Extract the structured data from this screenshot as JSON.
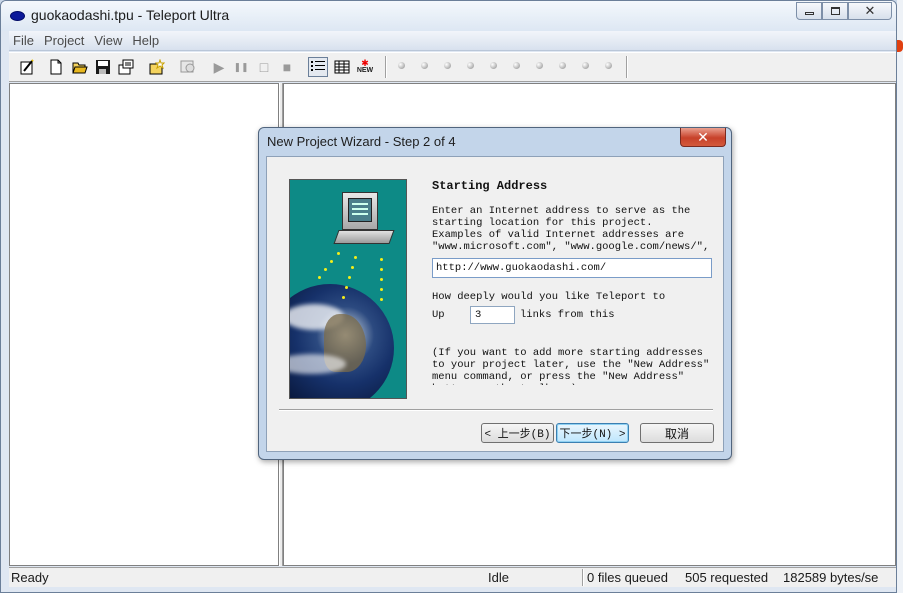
{
  "window": {
    "title": "guokaodashi.tpu - Teleport Ultra",
    "close_glyph": "✕"
  },
  "menu": [
    "File",
    "Project",
    "View",
    "Help"
  ],
  "toolbar": {
    "icons": [
      "new-wizard-icon",
      "new-file-icon",
      "open-folder-icon",
      "save-icon",
      "properties-icon",
      "new-project-icon",
      "browse-icon",
      "play-icon",
      "pause-icon",
      "stop-icon",
      "stop-all-icon",
      "list-view-icon",
      "grid-view-icon",
      "new-badge-icon"
    ],
    "play_glyph": "▶",
    "pause_glyph": "❚❚",
    "stop_glyph": "□",
    "stop_all_glyph": "■",
    "new_label": "NEW"
  },
  "status": {
    "ready": "Ready",
    "idle": "Idle",
    "files_queued": "0 files queued",
    "requested": "505 requested",
    "rate": "182589 bytes/se"
  },
  "dialog": {
    "title": "New Project Wizard - Step 2 of 4",
    "close_glyph": "✕",
    "heading": "Starting Address",
    "description": "Enter an Internet address to serve as the starting location for this project.  Examples of valid Internet addresses are \"www.microsoft.com\", \"www.google.com/news/\", and \"www.mydomain.com/index.html\".",
    "url_value": "http://www.guokaodashi.com/",
    "depth_question": "How deeply would you like Teleport to",
    "up_label": "Up",
    "depth_value": "3",
    "links_from": "links from this",
    "note": "(If you want to add more starting addresses to your project later, use the \"New Address\" menu command, or press the \"New Address\" button on the toolbar.)",
    "back_button": "< 上一步(B)",
    "next_button": "下一步(N) >",
    "cancel_button": "取消"
  }
}
